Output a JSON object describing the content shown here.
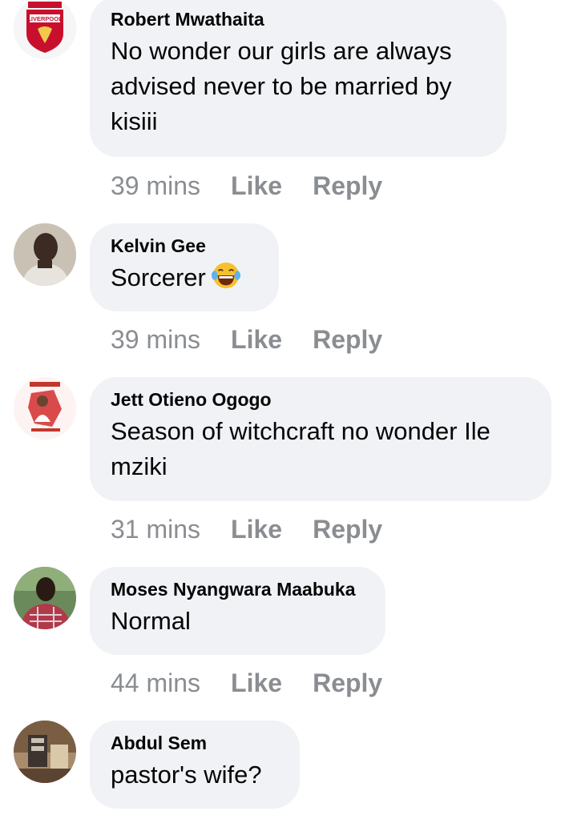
{
  "comments": [
    {
      "author": "Robert Mwathaita",
      "text": "No wonder our girls are always advised never to be married  by kisiii",
      "time": "39 mins",
      "like_label": "Like",
      "reply_label": "Reply",
      "avatar": "liverpool-crest-avatar",
      "avatar_text": "LIVERPOOL"
    },
    {
      "author": "Kelvin Gee",
      "text": "Sorcerer",
      "emoji": "laughing-tears-emoji",
      "time": "39 mins",
      "like_label": "Like",
      "reply_label": "Reply",
      "avatar": "person-photo-avatar"
    },
    {
      "author": "Jett Otieno Ogogo",
      "text": "Season of witchcraft no wonder Ile mziki",
      "time": "31 mins",
      "like_label": "Like",
      "reply_label": "Reply",
      "avatar": "poster-avatar"
    },
    {
      "author": "Moses Nyangwara Maabuka",
      "text": "Normal",
      "time": "44 mins",
      "like_label": "Like",
      "reply_label": "Reply",
      "avatar": "person-photo-avatar"
    },
    {
      "author": "Abdul Sem",
      "text": "pastor's wife?",
      "avatar": "room-photo-avatar"
    }
  ],
  "colors": {
    "bubble": "#f0f2f5",
    "meta": "#8a8d91",
    "text": "#050505"
  }
}
